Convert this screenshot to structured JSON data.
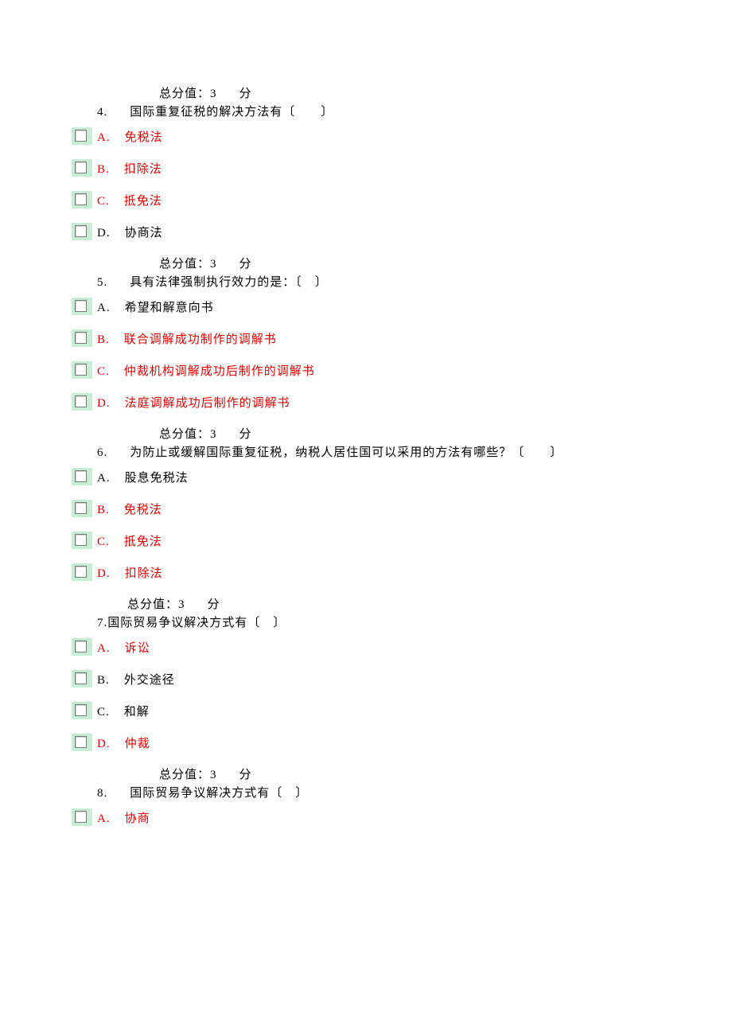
{
  "strings": {
    "score_prefix": "总分值：",
    "score_suffix": "分"
  },
  "questions": [
    {
      "score": "3",
      "num": "4.",
      "text": "国际重复征税的解决方法有〔　　〕",
      "options": [
        {
          "letter": "A.",
          "text": "免税法",
          "correct": true
        },
        {
          "letter": "B.",
          "text": "扣除法",
          "correct": true
        },
        {
          "letter": "C.",
          "text": "抵免法",
          "correct": true
        },
        {
          "letter": "D.",
          "text": "协商法",
          "correct": false
        }
      ]
    },
    {
      "score": "3",
      "num": "5.",
      "text": "具有法律强制执行效力的是：〔　〕",
      "options": [
        {
          "letter": "A.",
          "text": "希望和解意向书",
          "correct": false
        },
        {
          "letter": "B.",
          "text": "联合调解成功制作的调解书",
          "correct": true
        },
        {
          "letter": "C.",
          "text": "仲裁机构调解成功后制作的调解书",
          "correct": true
        },
        {
          "letter": "D.",
          "text": "法庭调解成功后制作的调解书",
          "correct": true
        }
      ]
    },
    {
      "score": "3",
      "num": "6.",
      "text": "为防止或缓解国际重复征税，纳税人居住国可以采用的方法有哪些？〔　　〕",
      "options": [
        {
          "letter": "A.",
          "text": "股息免税法",
          "correct": false
        },
        {
          "letter": "B.",
          "text": "免税法",
          "correct": true
        },
        {
          "letter": "C.",
          "text": "抵免法",
          "correct": true
        },
        {
          "letter": "D.",
          "text": "扣除法",
          "correct": true
        }
      ]
    },
    {
      "score": "3",
      "num_inline": "7.",
      "text": "国际贸易争议解决方式有〔　〕",
      "options": [
        {
          "letter": "A.",
          "text": "诉讼",
          "correct": true
        },
        {
          "letter": "B.",
          "text": "外交途径",
          "correct": false
        },
        {
          "letter": "C.",
          "text": "和解",
          "correct": false
        },
        {
          "letter": "D.",
          "text": "仲裁",
          "correct": true
        }
      ]
    },
    {
      "score": "3",
      "num": "8.",
      "text": "国际贸易争议解决方式有〔　〕",
      "options": [
        {
          "letter": "A.",
          "text": "协商",
          "correct": true
        }
      ]
    }
  ]
}
